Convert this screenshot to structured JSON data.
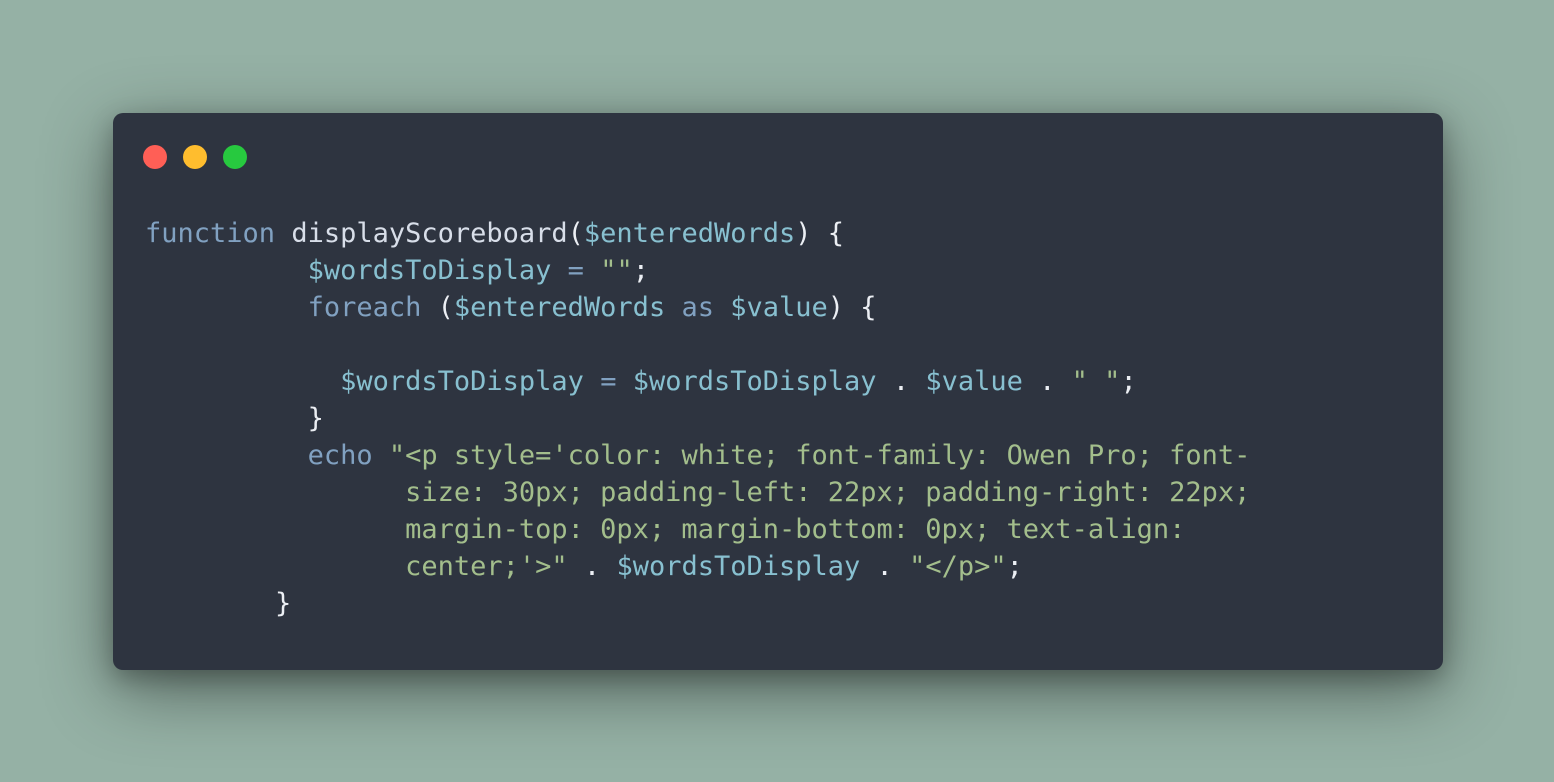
{
  "window": {
    "controls": {
      "close_color": "#ff5f56",
      "minimize_color": "#ffbd2e",
      "maximize_color": "#27c93f"
    }
  },
  "code": {
    "lines": [
      [
        {
          "t": "function",
          "c": "kw"
        },
        {
          "t": " ",
          "c": "pn"
        },
        {
          "t": "displayScoreboard",
          "c": "fn"
        },
        {
          "t": "(",
          "c": "pn"
        },
        {
          "t": "$enteredWords",
          "c": "var"
        },
        {
          "t": ") {",
          "c": "pn"
        }
      ],
      [
        {
          "t": "          ",
          "c": "pn"
        },
        {
          "t": "$wordsToDisplay",
          "c": "var"
        },
        {
          "t": " ",
          "c": "pn"
        },
        {
          "t": "=",
          "c": "op"
        },
        {
          "t": " ",
          "c": "pn"
        },
        {
          "t": "\"\"",
          "c": "str"
        },
        {
          "t": ";",
          "c": "pn"
        }
      ],
      [
        {
          "t": "          ",
          "c": "pn"
        },
        {
          "t": "foreach",
          "c": "kw"
        },
        {
          "t": " (",
          "c": "pn"
        },
        {
          "t": "$enteredWords",
          "c": "var"
        },
        {
          "t": " ",
          "c": "pn"
        },
        {
          "t": "as",
          "c": "kw"
        },
        {
          "t": " ",
          "c": "pn"
        },
        {
          "t": "$value",
          "c": "var"
        },
        {
          "t": ") {",
          "c": "pn"
        }
      ],
      [],
      [
        {
          "t": "            ",
          "c": "pn"
        },
        {
          "t": "$wordsToDisplay",
          "c": "var"
        },
        {
          "t": " ",
          "c": "pn"
        },
        {
          "t": "=",
          "c": "op"
        },
        {
          "t": " ",
          "c": "pn"
        },
        {
          "t": "$wordsToDisplay",
          "c": "var"
        },
        {
          "t": " . ",
          "c": "pn"
        },
        {
          "t": "$value",
          "c": "var"
        },
        {
          "t": " . ",
          "c": "pn"
        },
        {
          "t": "\" \"",
          "c": "str"
        },
        {
          "t": ";",
          "c": "pn"
        }
      ],
      [
        {
          "t": "          ",
          "c": "pn"
        },
        {
          "t": "}",
          "c": "pn"
        }
      ],
      [
        {
          "t": "          ",
          "c": "pn"
        },
        {
          "t": "echo",
          "c": "kw"
        },
        {
          "t": " ",
          "c": "pn"
        },
        {
          "t": "\"<p style='color: white; font-family: Owen Pro; font-",
          "c": "str"
        }
      ],
      [
        {
          "t": "                ",
          "c": "pn"
        },
        {
          "t": "size: 30px; padding-left: 22px; padding-right: 22px;",
          "c": "str"
        }
      ],
      [
        {
          "t": "                ",
          "c": "pn"
        },
        {
          "t": "margin-top: 0px; margin-bottom: 0px; text-align:",
          "c": "str"
        }
      ],
      [
        {
          "t": "                ",
          "c": "pn"
        },
        {
          "t": "center;'>\"",
          "c": "str"
        },
        {
          "t": " . ",
          "c": "pn"
        },
        {
          "t": "$wordsToDisplay",
          "c": "var"
        },
        {
          "t": " . ",
          "c": "pn"
        },
        {
          "t": "\"</p>\"",
          "c": "str"
        },
        {
          "t": ";",
          "c": "pn"
        }
      ],
      [
        {
          "t": "        ",
          "c": "pn"
        },
        {
          "t": "}",
          "c": "pn"
        }
      ]
    ]
  }
}
